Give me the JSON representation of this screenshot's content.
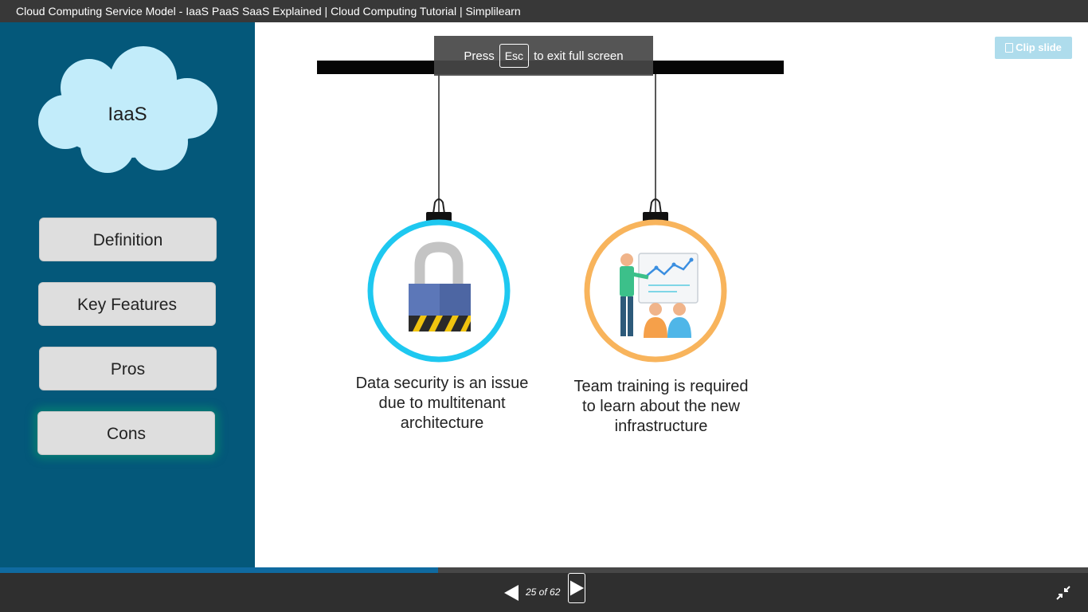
{
  "window": {
    "title": "Cloud Computing Service Model - IaaS PaaS SaaS Explained | Cloud Computing Tutorial | Simplilearn"
  },
  "sidebar": {
    "cloud_label": "IaaS",
    "items": [
      {
        "label": "Definition"
      },
      {
        "label": "Key Features"
      },
      {
        "label": "Pros"
      },
      {
        "label": "Cons",
        "active": true
      }
    ]
  },
  "fullscreen_notice": {
    "prefix": "Press",
    "key": "Esc",
    "suffix": "to exit full screen"
  },
  "clip_slide": {
    "label": "Clip slide",
    "icon": "clip-icon"
  },
  "slide": {
    "items": [
      {
        "icon": "padlock-icon",
        "ring_color": "#1ec8f0",
        "caption_lines": [
          "Data security is an issue",
          "due to multitenant",
          "architecture"
        ]
      },
      {
        "icon": "team-training-icon",
        "ring_color": "#f8b45c",
        "caption_lines": [
          "Team training is required",
          "to learn about the new",
          "infrastructure"
        ]
      }
    ]
  },
  "player": {
    "current_page": 25,
    "total_pages": 62,
    "page_text": "25 of 62",
    "progress": 0.403
  },
  "colors": {
    "sidebar": "#04587a",
    "cloud": "#c2ecfa",
    "accent": "#0f6aa0"
  }
}
